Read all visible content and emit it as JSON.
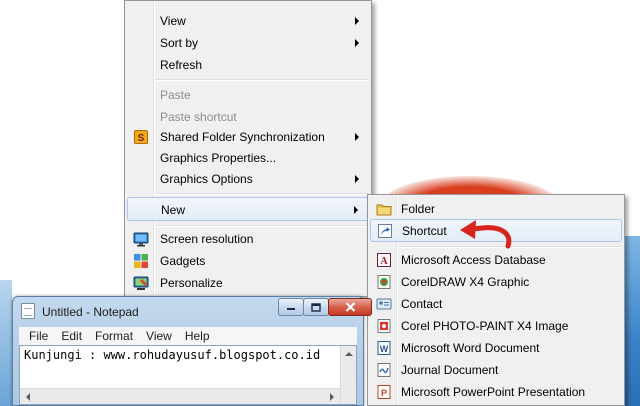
{
  "context_menu": {
    "items": [
      {
        "label": "View",
        "submenu": true
      },
      {
        "label": "Sort by",
        "submenu": true
      },
      {
        "label": "Refresh"
      },
      {
        "label": "Paste",
        "disabled": true
      },
      {
        "label": "Paste shortcut",
        "disabled": true
      },
      {
        "label": "Shared Folder Synchronization",
        "submenu": true,
        "icon": "shared-folder-sync-icon"
      },
      {
        "label": "Graphics Properties..."
      },
      {
        "label": "Graphics Options",
        "submenu": true
      },
      {
        "label": "New",
        "submenu": true,
        "highlighted": true
      },
      {
        "label": "Screen resolution",
        "icon": "screen-resolution-icon"
      },
      {
        "label": "Gadgets",
        "icon": "gadgets-icon"
      },
      {
        "label": "Personalize",
        "icon": "personalize-icon"
      }
    ]
  },
  "new_submenu": {
    "items": [
      {
        "label": "Folder",
        "icon": "folder-icon"
      },
      {
        "label": "Shortcut",
        "icon": "shortcut-icon",
        "highlighted": true
      },
      {
        "label": "Microsoft Access Database",
        "icon": "access-database-icon"
      },
      {
        "label": "CorelDRAW X4 Graphic",
        "icon": "coreldraw-icon"
      },
      {
        "label": "Contact",
        "icon": "contact-icon"
      },
      {
        "label": "Corel PHOTO-PAINT X4 Image",
        "icon": "photo-paint-icon"
      },
      {
        "label": "Microsoft Word Document",
        "icon": "word-document-icon"
      },
      {
        "label": "Journal Document",
        "icon": "journal-document-icon"
      },
      {
        "label": "Microsoft PowerPoint Presentation",
        "icon": "powerpoint-icon"
      }
    ]
  },
  "notepad": {
    "title": "Untitled - Notepad",
    "menu": [
      "File",
      "Edit",
      "Format",
      "View",
      "Help"
    ],
    "text": "Kunjungi : www.rohudayusuf.blogspot.co.id"
  },
  "colors": {
    "menu_bg": "#f0f0f0",
    "highlight_border": "#a8c7ec",
    "annotation_arrow": "#d8231f",
    "wallpaper_red": "#d83c1c",
    "wallpaper_blue": "#3b84c8"
  }
}
